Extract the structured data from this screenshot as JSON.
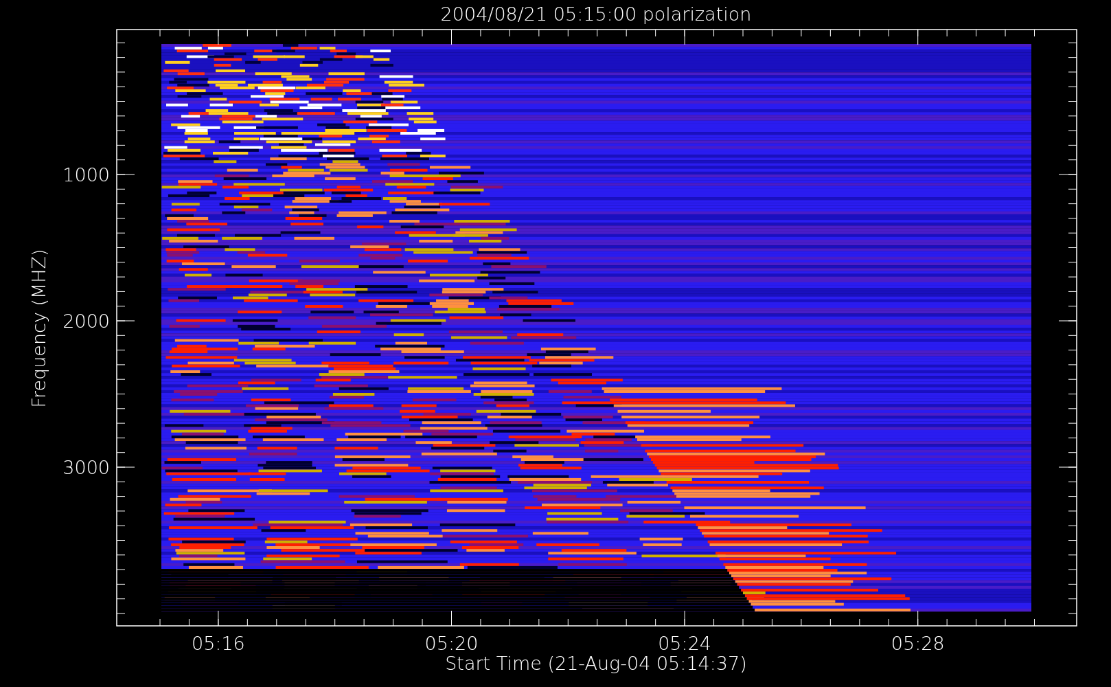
{
  "title": "2004/08/21 05:15:00 polarization",
  "x_axis": {
    "label": "Start Time (21-Aug-04 05:14:37)",
    "ticks": [
      "05:16",
      "05:20",
      "05:24",
      "05:28"
    ]
  },
  "y_axis": {
    "label": "Frequency (MHZ)",
    "ticks": [
      "1000",
      "2000",
      "3000"
    ]
  }
}
